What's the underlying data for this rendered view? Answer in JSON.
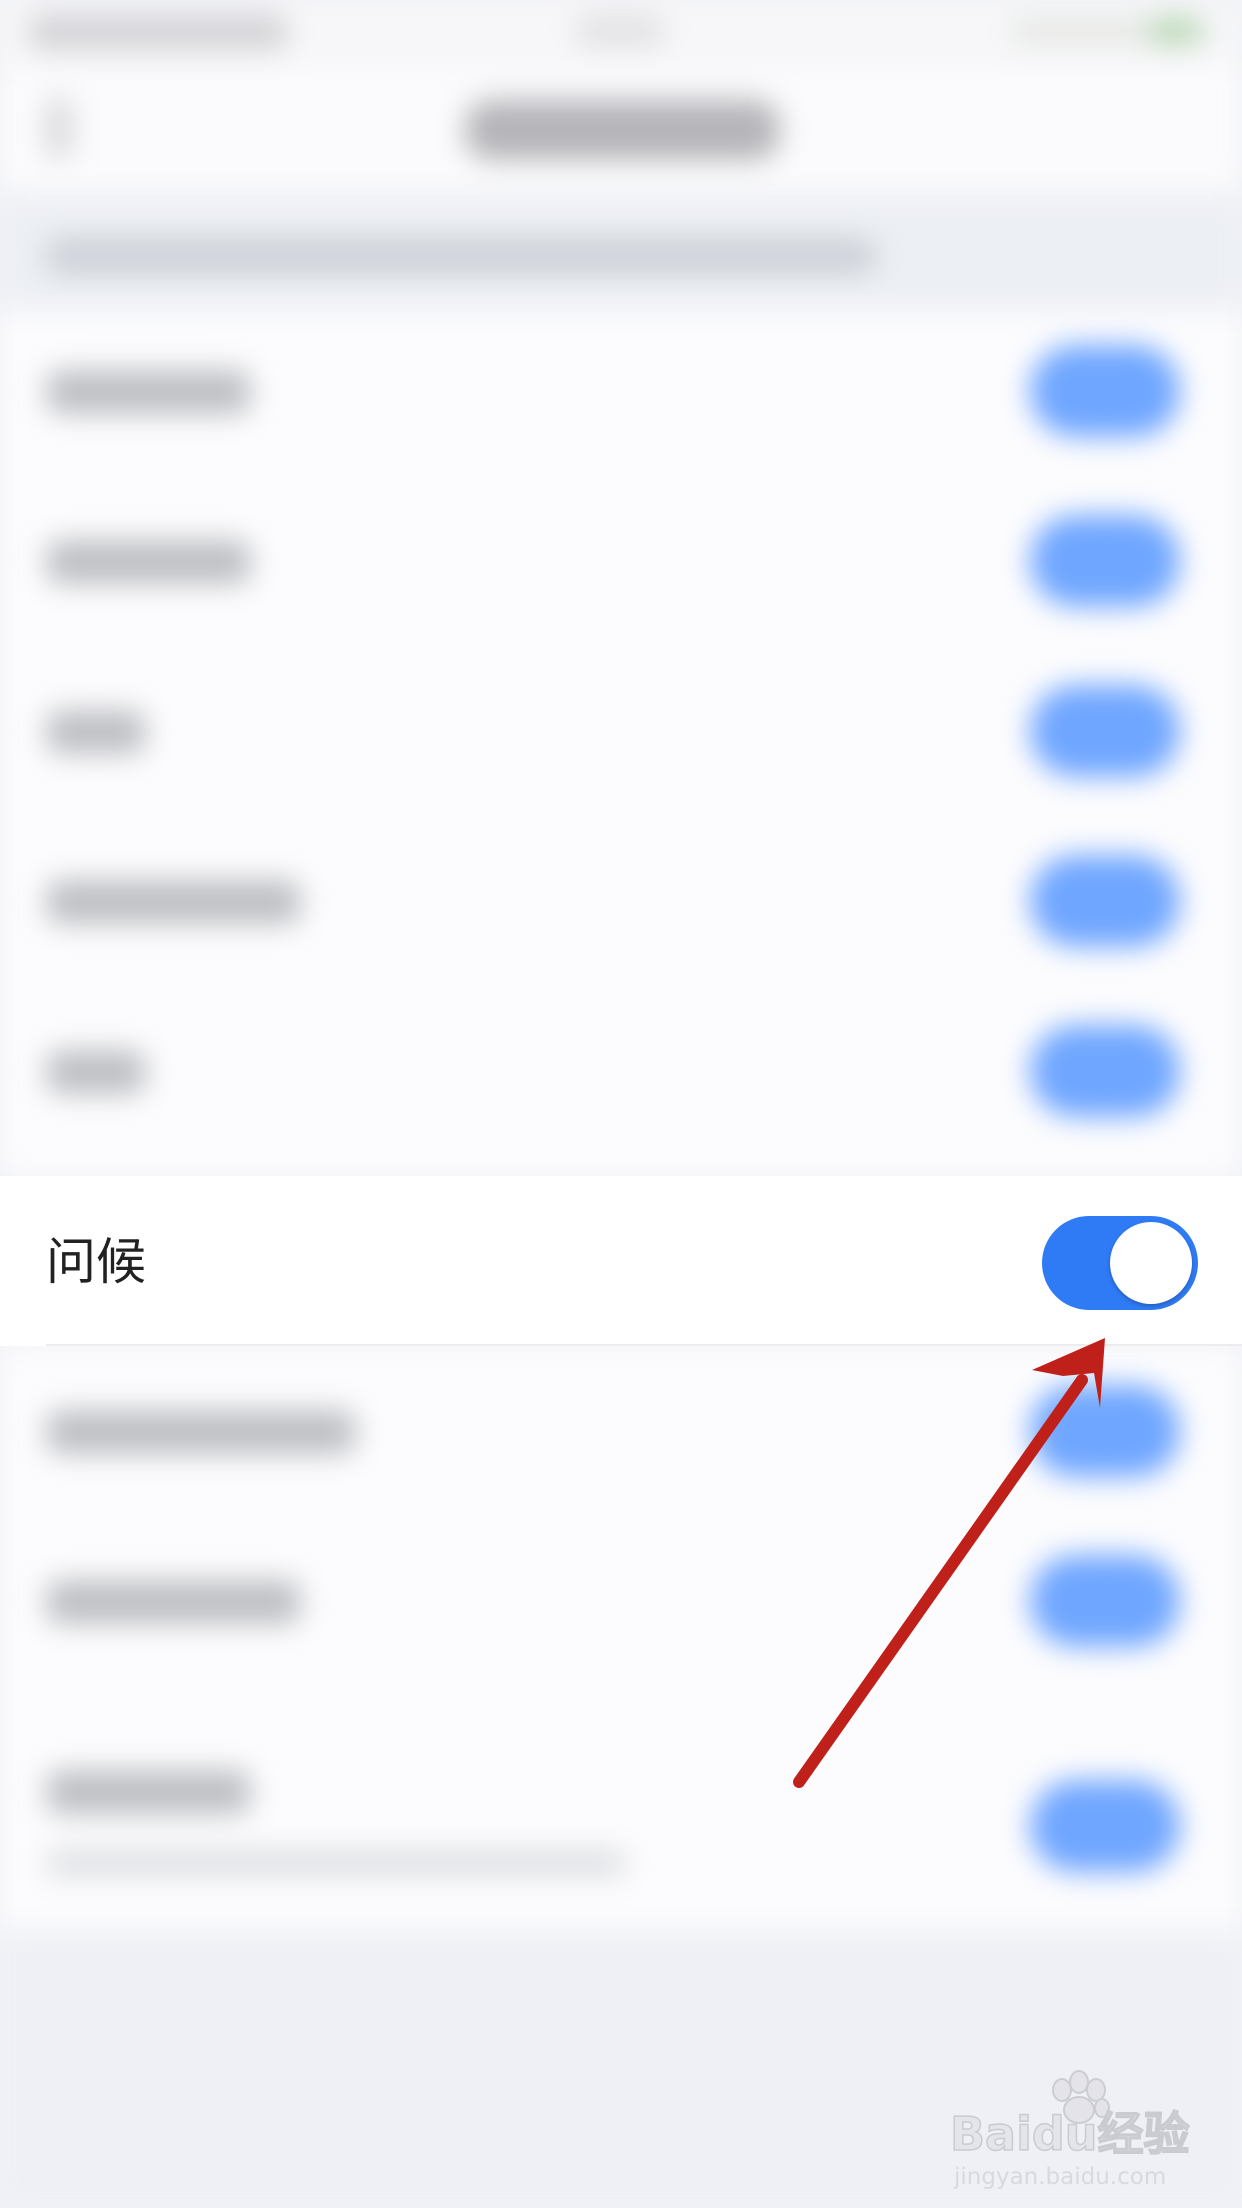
{
  "greeting_row": {
    "label": "问候",
    "toggle_on": true
  },
  "colors": {
    "toggle_active": "#2f7bf6",
    "annotation_arrow": "#c0201a",
    "background": "#f1f2f6"
  },
  "watermark": {
    "brand": "Baidu经验",
    "url": "jingyan.baidu.com"
  }
}
